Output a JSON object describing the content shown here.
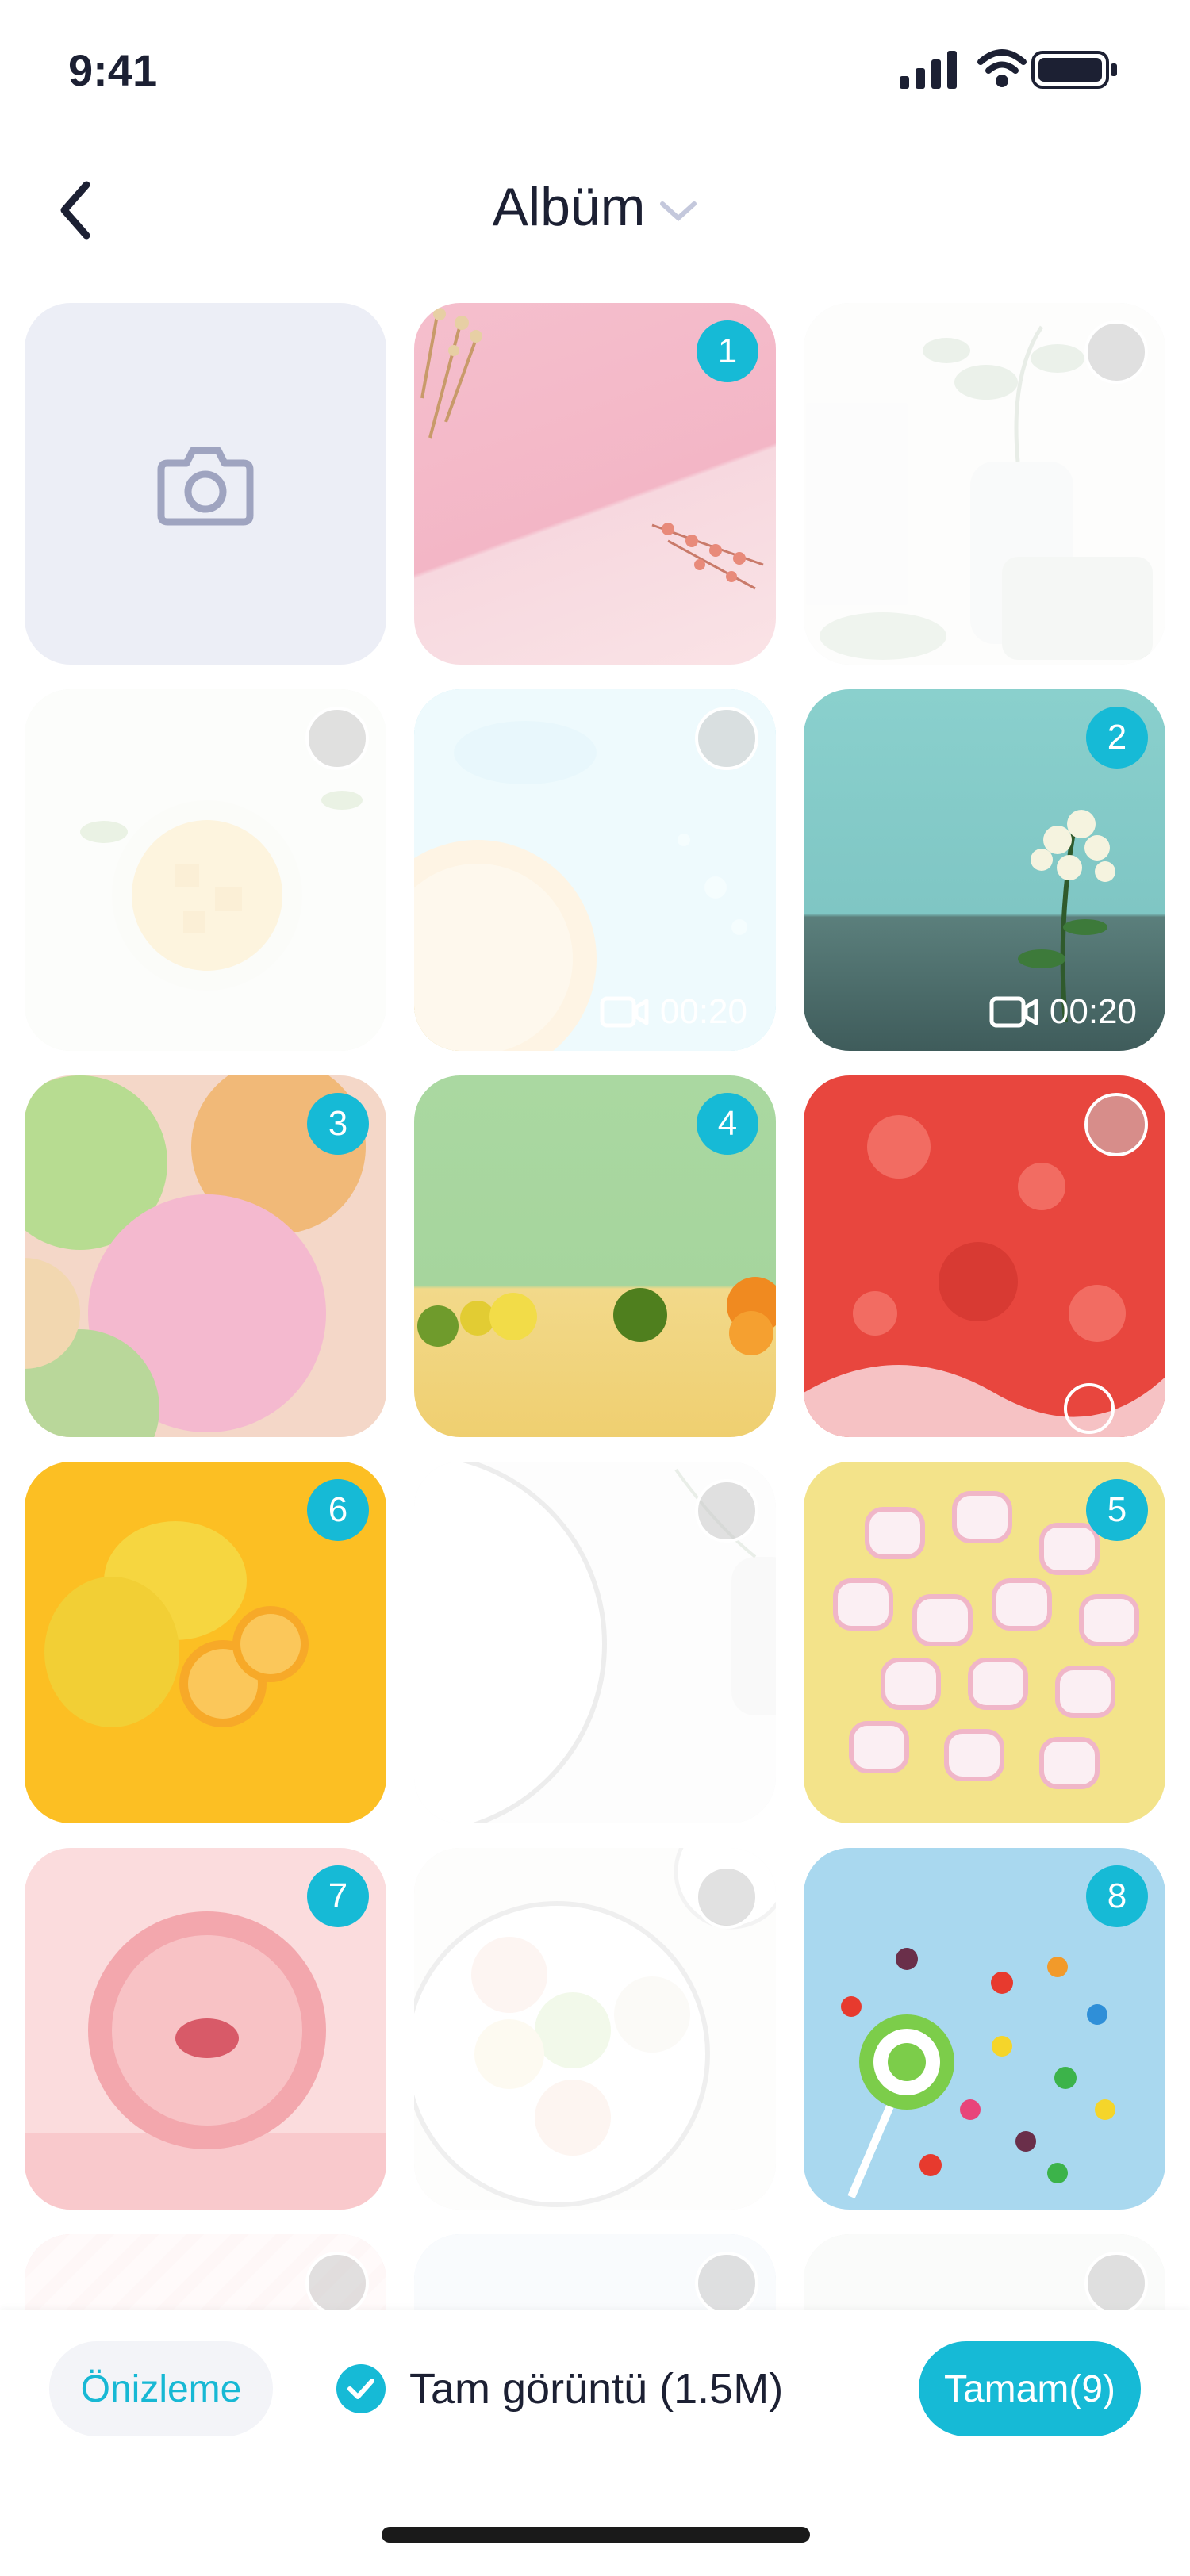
{
  "status": {
    "time": "9:41"
  },
  "header": {
    "title": "Albüm"
  },
  "video_duration": "00:20",
  "badges": [
    "1",
    "2",
    "3",
    "4",
    "6",
    "5",
    "7",
    "8"
  ],
  "footer": {
    "preview_label": "Önizleme",
    "full_image_label": "Tam görüntü (1.5M)",
    "done_label": "Tamam(9)"
  },
  "colors": {
    "accent": "#16bad6",
    "text": "#1c2033",
    "camera_tile": "#eceef6"
  },
  "icons": [
    "signal-icon",
    "wifi-icon",
    "battery-icon",
    "back-chevron-icon",
    "chevron-down-icon",
    "camera-icon",
    "video-camera-icon",
    "checkmark-icon"
  ]
}
